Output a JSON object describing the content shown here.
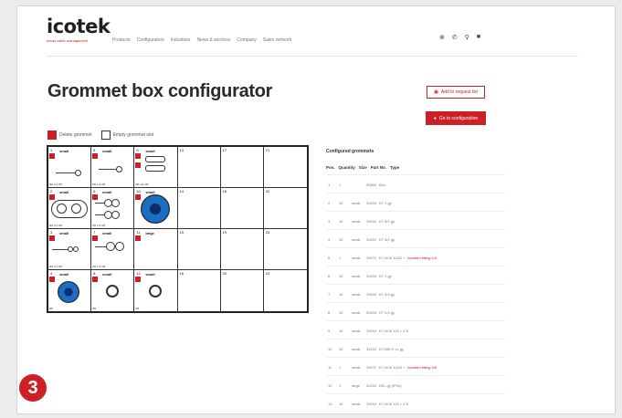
{
  "header": {
    "logo": "icotek",
    "tagline": "smart cable management",
    "nav": [
      "Products",
      "Configurators",
      "Industries",
      "News & services",
      "Company",
      "Sales network"
    ],
    "icons": [
      "globe-icon",
      "phone-icon",
      "search-icon",
      "cart-icon"
    ]
  },
  "page": {
    "title": "Grommet box configurator",
    "add_request_label": "Add to request list",
    "go_config_label": "Go to configuration"
  },
  "legend": {
    "delete_label": "Delete grommet",
    "empty_label": "Empty grommet slot"
  },
  "grid": {
    "cells": [
      {
        "pos": "1",
        "size": "small",
        "pn": "Ø6  1/4  3/8",
        "filled": true
      },
      {
        "pos": "5",
        "size": "small",
        "pn": "Ø6  1/4  3/8",
        "filled": true
      },
      {
        "pos": "9",
        "size": "small",
        "pn": "Ø6  1/4  3/8",
        "filled": true
      },
      {
        "pos": "13",
        "size": "",
        "pn": "",
        "filled": false
      },
      {
        "pos": "17",
        "size": "",
        "pn": "",
        "filled": false
      },
      {
        "pos": "21",
        "size": "",
        "pn": "",
        "filled": false
      },
      {
        "pos": "2",
        "size": "small",
        "pn": "Ø6  1/4  3/8",
        "filled": true
      },
      {
        "pos": "6",
        "size": "small",
        "pn": "Ø6  1/4  3/8",
        "filled": true
      },
      {
        "pos": "10",
        "size": "small",
        "pn": "",
        "filled": true
      },
      {
        "pos": "14",
        "size": "",
        "pn": "",
        "filled": false
      },
      {
        "pos": "18",
        "size": "",
        "pn": "",
        "filled": false
      },
      {
        "pos": "22",
        "size": "",
        "pn": "",
        "filled": false
      },
      {
        "pos": "3",
        "size": "small",
        "pn": "Ø6  1/4  3/8",
        "filled": true
      },
      {
        "pos": "7",
        "size": "small",
        "pn": "Ø6  1/4  3/8",
        "filled": true
      },
      {
        "pos": "11",
        "size": "large",
        "pn": "",
        "filled": true
      },
      {
        "pos": "15",
        "size": "",
        "pn": "",
        "filled": false
      },
      {
        "pos": "19",
        "size": "",
        "pn": "",
        "filled": false
      },
      {
        "pos": "23",
        "size": "",
        "pn": "",
        "filled": false
      },
      {
        "pos": "4",
        "size": "small",
        "pn": "Ø6",
        "filled": true
      },
      {
        "pos": "8",
        "size": "small",
        "pn": "Ø6",
        "filled": true
      },
      {
        "pos": "12",
        "size": "small",
        "pn": "Ø6",
        "filled": true
      },
      {
        "pos": "16",
        "size": "",
        "pn": "",
        "filled": false
      },
      {
        "pos": "20",
        "size": "",
        "pn": "",
        "filled": false
      },
      {
        "pos": "24",
        "size": "",
        "pn": "",
        "filled": false
      }
    ]
  },
  "configured": {
    "title": "Configured grommets",
    "headers": [
      "Pos.",
      "Quantity",
      "Size",
      "Part No.",
      "Type"
    ],
    "rows": [
      {
        "pos": "1",
        "qty": "1",
        "size": "",
        "part": "00000",
        "type": "Box",
        "red": ""
      },
      {
        "pos": "2",
        "qty": "10",
        "size": "small",
        "part": "33034",
        "type": "KT 2 gy",
        "red": ""
      },
      {
        "pos": "3",
        "qty": "10",
        "size": "small",
        "part": "33031",
        "type": "KT 8/1 gy",
        "red": ""
      },
      {
        "pos": "4",
        "qty": "10",
        "size": "small",
        "part": "33037",
        "type": "KT 4/2 gy",
        "red": ""
      },
      {
        "pos": "5",
        "qty": "1",
        "size": "small",
        "part": "33071",
        "type": "KT-M-M 115/2 +",
        "red": "Included fitting 1/4"
      },
      {
        "pos": "6",
        "qty": "10",
        "size": "small",
        "part": "33034",
        "type": "KT 2 gy",
        "red": ""
      },
      {
        "pos": "7",
        "qty": "10",
        "size": "small",
        "part": "33009",
        "type": "KT 4/4 gy",
        "red": ""
      },
      {
        "pos": "8",
        "qty": "10",
        "size": "small",
        "part": "33006",
        "type": "KT 2/4 gy",
        "red": ""
      },
      {
        "pos": "9",
        "qty": "10",
        "size": "small",
        "part": "33015",
        "type": "KT-M-M 115 = 1.5",
        "red": ""
      },
      {
        "pos": "10",
        "qty": "10",
        "size": "small",
        "part": "33122",
        "type": "KT-M5+2 x1 gy",
        "red": ""
      },
      {
        "pos": "11",
        "qty": "1",
        "size": "small",
        "part": "33072",
        "type": "KT-M-M 115/4 +",
        "red": "Included fitting 3/8"
      },
      {
        "pos": "12",
        "qty": "1",
        "size": "large",
        "part": "43232",
        "type": "KEL gy (IP54)",
        "red": ""
      },
      {
        "pos": "13",
        "qty": "10",
        "size": "small",
        "part": "33015",
        "type": "KT-M-M 115 = 1.5",
        "red": ""
      }
    ]
  },
  "badge": "3",
  "colors": {
    "accent": "#cc2027",
    "ring_blue": "#1b6fc1"
  }
}
